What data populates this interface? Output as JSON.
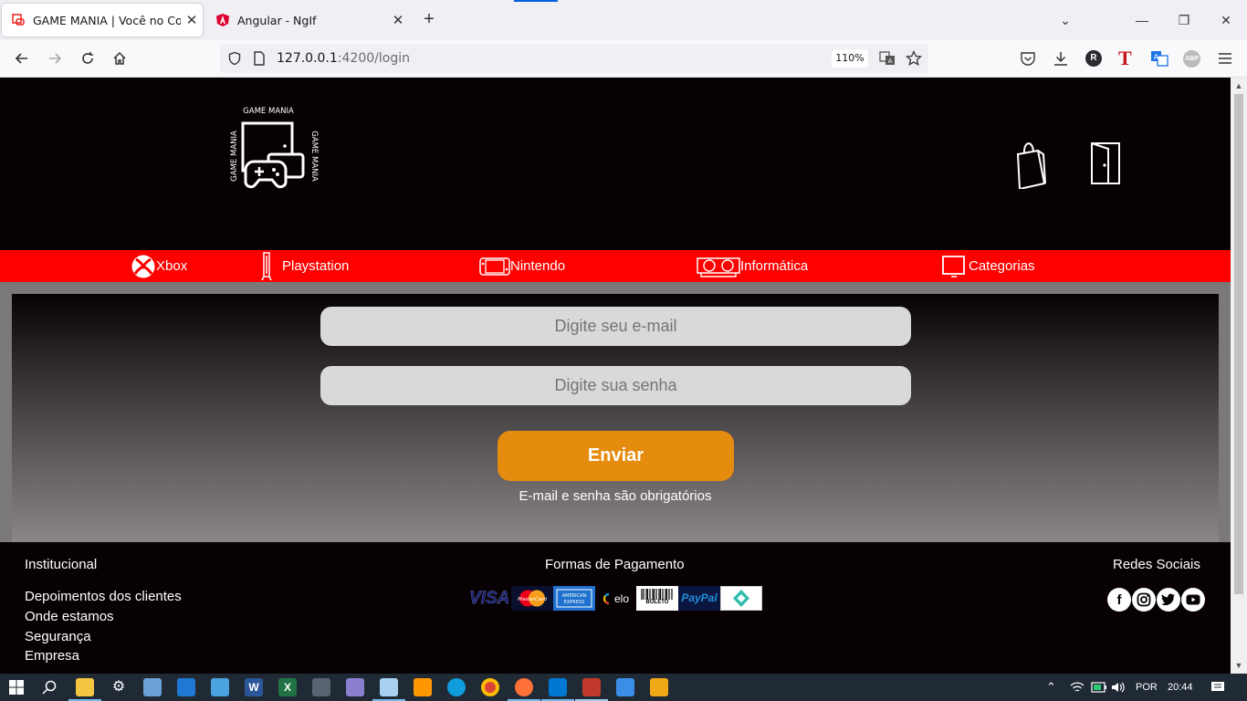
{
  "browser": {
    "tabs": [
      {
        "title": "GAME MANIA | Você no Controle",
        "active": true
      },
      {
        "title": "Angular - NgIf",
        "active": false
      }
    ],
    "new_tab": "+",
    "url_host": "127.0.0.1",
    "url_path": ":4200/login",
    "zoom": "110%",
    "window_controls": {
      "minimize": "—",
      "restore": "❐",
      "close": "✕"
    },
    "tab_overflow": "⌄"
  },
  "header": {
    "logo_text": "GAME MANIA",
    "icons": [
      "shopping-bag-icon",
      "door-icon"
    ]
  },
  "categories": [
    {
      "label": "Xbox",
      "icon": "xbox-icon"
    },
    {
      "label": "Playstation",
      "icon": "playstation-icon"
    },
    {
      "label": "Nintendo",
      "icon": "nintendo-switch-icon"
    },
    {
      "label": "Informática",
      "icon": "gpu-icon"
    },
    {
      "label": "Categorias",
      "icon": "monitor-icon"
    }
  ],
  "login": {
    "email_placeholder": "Digite seu e-mail",
    "password_placeholder": "Digite sua senha",
    "submit_label": "Enviar",
    "validation_message": "E-mail e senha são obrigatórios"
  },
  "footer": {
    "institutional": {
      "title": "Institucional",
      "links": [
        "Depoimentos dos clientes",
        "Onde estamos",
        "Segurança",
        "Empresa"
      ]
    },
    "payments": {
      "title": "Formas de Pagamento",
      "methods": [
        "VISA",
        "MasterCard",
        "American Express",
        "elo",
        "BOLETO",
        "PayPal",
        "Pix"
      ]
    },
    "social": {
      "title": "Redes Sociais",
      "networks": [
        "facebook-icon",
        "instagram-icon",
        "twitter-icon",
        "youtube-icon"
      ]
    }
  },
  "taskbar": {
    "language": "POR",
    "time": "20:44"
  }
}
